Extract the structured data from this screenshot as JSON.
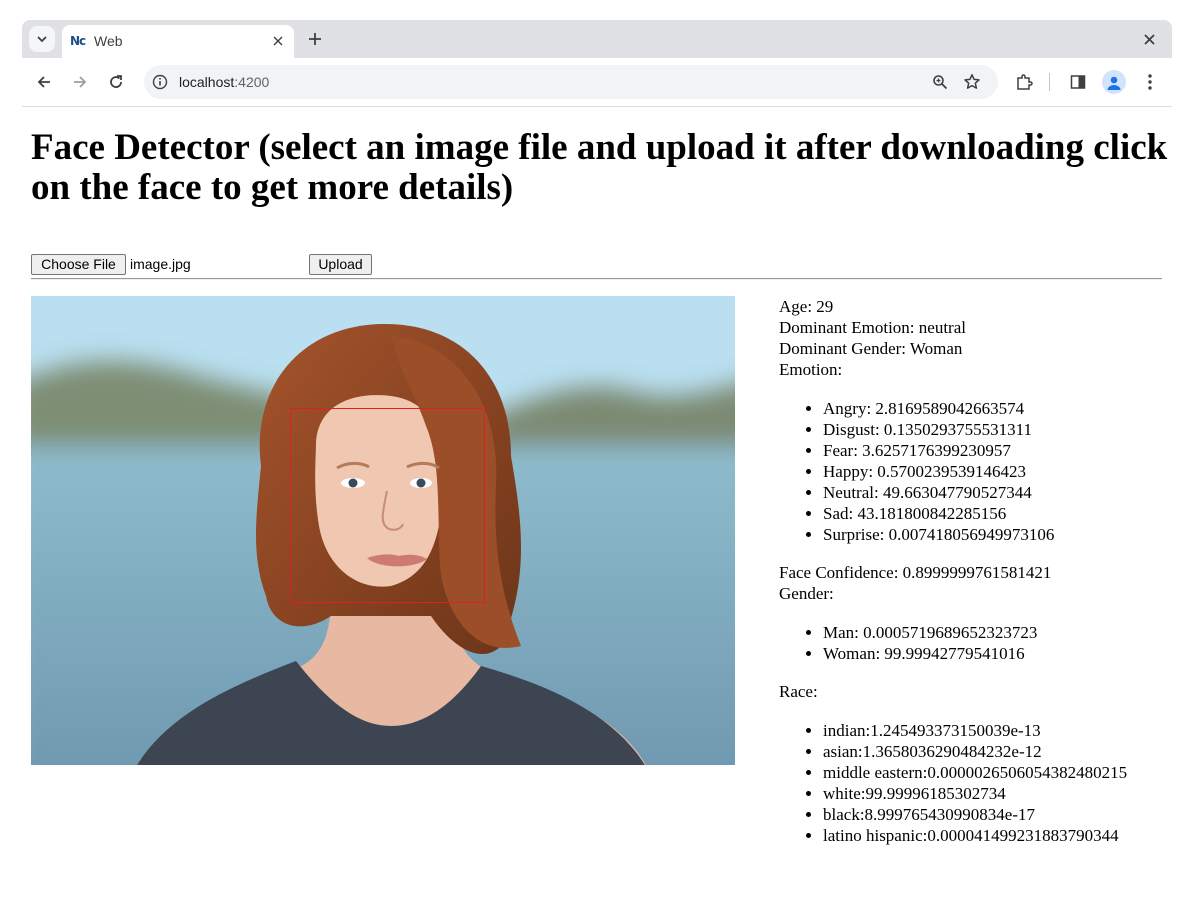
{
  "browser": {
    "tab_title": "Web",
    "favicon_text": "Nc",
    "url_host": "localhost",
    "url_port": ":4200"
  },
  "page": {
    "title": "Face Detector (select an image file and upload it after downloading click on the face to get more details)",
    "choose_file_label": "Choose File",
    "file_name": "image.jpg",
    "upload_label": "Upload"
  },
  "details": {
    "age": "Age: 29",
    "dominant_emotion": "Dominant Emotion: neutral",
    "dominant_gender": "Dominant Gender: Woman",
    "emotion_heading": "Emotion:",
    "emotions": [
      "Angry: 2.8169589042663574",
      "Disgust: 0.1350293755531311",
      "Fear: 3.6257176399230957",
      "Happy: 0.5700239539146423",
      "Neutral: 49.663047790527344",
      "Sad: 43.181800842285156",
      "Surprise: 0.007418056949973106"
    ],
    "face_confidence": "Face Confidence: 0.8999999761581421",
    "gender_heading": "Gender:",
    "genders": [
      "Man: 0.0005719689652323723",
      "Woman: 99.99942779541016"
    ],
    "race_heading": "Race:",
    "races": [
      "indian:1.245493373150039e-13",
      "asian:1.3658036290484232e-12",
      "middle eastern:0.0000026506054382480215",
      "white:99.99996185302734",
      "black:8.999765430990834e-17",
      "latino hispanic:0.000041499231883790344"
    ]
  },
  "colors": {
    "face_box": "#e02020",
    "tab_strip": "#dfe1e5",
    "omnibox": "#f1f3f4"
  }
}
